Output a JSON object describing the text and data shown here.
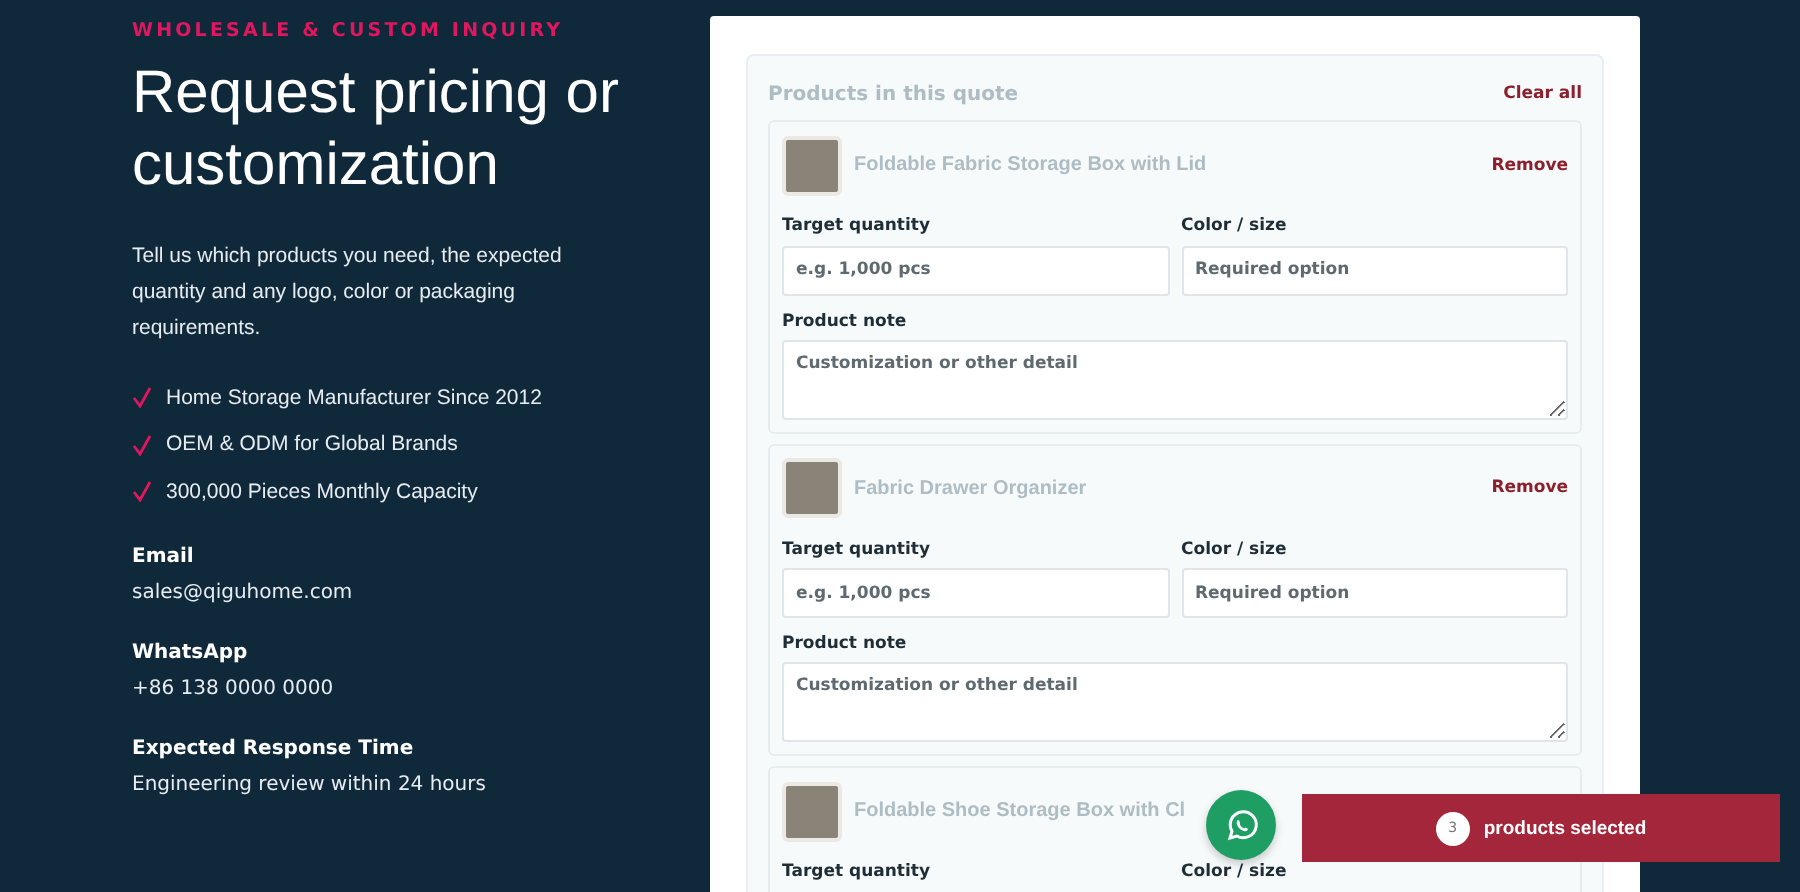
{
  "intro": {
    "eyebrow": "WHOLESALE & CUSTOM INQUIRY",
    "title": "Request pricing or customization",
    "description": "Tell us which products you need, the expected quantity and any logo, color or packaging requirements.",
    "highlights": [
      "Home Storage Manufacturer Since 2012",
      "OEM & ODM for Global Brands",
      "300,000 Pieces Monthly Capacity"
    ],
    "contacts": [
      {
        "label": "Email",
        "value": "sales@qiguhome.com"
      },
      {
        "label": "WhatsApp",
        "value": "+86 138 0000 0000"
      },
      {
        "label": "Expected Response Time",
        "value": "Engineering review within 24 hours"
      }
    ]
  },
  "quote": {
    "heading": "Products in this quote",
    "clear_label": "Clear all",
    "products": [
      {
        "name": "Foldable Fabric Storage Box with Lid",
        "remove_label": "Remove",
        "fields": [
          {
            "label": "Target quantity",
            "placeholder": "e.g. 1,000 pcs"
          },
          {
            "label": "Color / size",
            "placeholder": "Required option"
          }
        ],
        "note": {
          "label": "Product note",
          "placeholder": "Customization or other detail"
        }
      },
      {
        "name": "Fabric Drawer Organizer",
        "remove_label": "Remove",
        "fields": [
          {
            "label": "Target quantity",
            "placeholder": "e.g. 1,000 pcs"
          },
          {
            "label": "Color / size",
            "placeholder": "Required option"
          }
        ],
        "note": {
          "label": "Product note",
          "placeholder": "Customization or other detail"
        }
      },
      {
        "name": "Foldable Shoe Storage Box with Cl",
        "fields": [
          {
            "label": "Target quantity"
          },
          {
            "label": "Color / size"
          }
        ]
      }
    ]
  },
  "selection_bar": {
    "count": "3",
    "label": "products selected"
  }
}
